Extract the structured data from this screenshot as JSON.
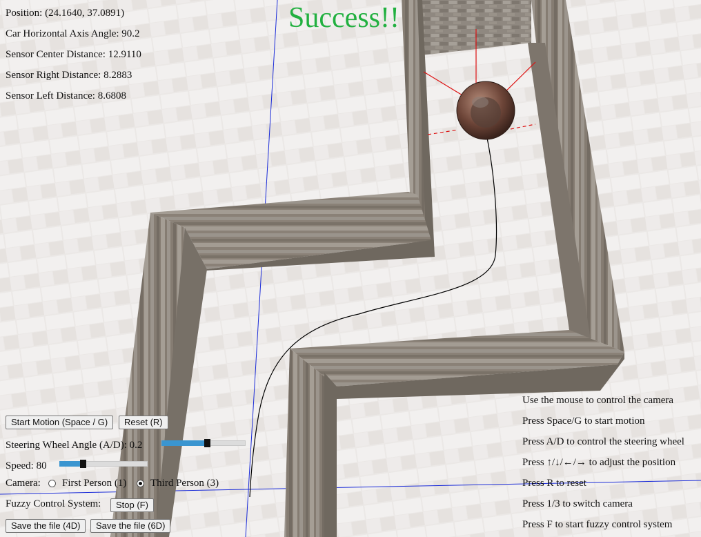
{
  "hud": {
    "position": "Position: (24.1640, 37.0891)",
    "angle": "Car Horizontal Axis Angle: 90.2",
    "sensor_center": "Sensor Center Distance: 12.9110",
    "sensor_right": "Sensor Right Distance: 8.2883",
    "sensor_left": "Sensor Left Distance: 8.6808"
  },
  "status": {
    "message": "Success!!",
    "color": "#22b040"
  },
  "controls": {
    "start_button": "Start Motion (Space / G)",
    "reset_button": "Reset (R)",
    "steering_label": "Steering Wheel Angle (A/D): 0.2",
    "steering_level": 0.55,
    "speed_label": "Speed: 80",
    "speed_level": 0.25,
    "camera_label": "Camera:",
    "camera_options": [
      {
        "label": "First Person (1)",
        "selected": false
      },
      {
        "label": "Third Person (3)",
        "selected": true
      }
    ],
    "fuzzy_label": "Fuzzy Control System:",
    "fuzzy_button": "Stop (F)",
    "save4d_button": "Save the file (4D)",
    "save6d_button": "Save the file (6D)"
  },
  "help": [
    "Use the mouse to control the camera",
    "Press Space/G to start motion",
    "Press A/D to control the steering wheel",
    "Press ↑/↓/←/→ to adjust the position",
    "Press R to reset",
    "Press 1/3 to switch camera",
    "Press F to start fuzzy control system"
  ],
  "colors": {
    "accent": "#3a95d0",
    "wall": "#8a8278",
    "sensor_line": "#dd1111",
    "axis_line": "#1a2bd8",
    "path_line": "#000000"
  }
}
